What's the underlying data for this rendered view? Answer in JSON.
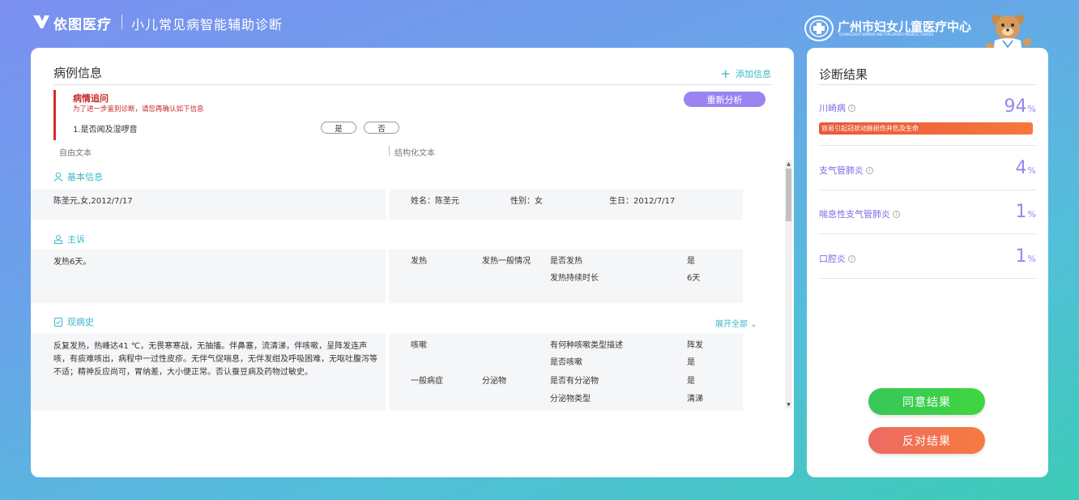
{
  "header": {
    "brand": "依图医疗",
    "app_title": "小儿常见病智能辅助诊断",
    "hospital_name": "广州市妇女儿童医疗中心",
    "hospital_en": "GUANGZHOU WOMEN AND CHILDREN'S MEDICAL CENTER"
  },
  "case": {
    "title": "病例信息",
    "add_info": "添加信息",
    "inquiry": {
      "title": "病情追问",
      "hint": "为了进一步鉴别诊断，请您再确认如下信息",
      "reanalyze": "重新分析",
      "question": "1.是否闻及湿啰音",
      "yes": "是",
      "no": "否"
    },
    "free_text_label": "自由文本",
    "struct_text_label": "结构化文本",
    "basic": {
      "heading": "基本信息",
      "free_text": "陈圣元,女,2012/7/17",
      "name": "姓名：陈圣元",
      "gender": "性别：女",
      "birthday": "生日：2012/7/17"
    },
    "complaint": {
      "heading": "主诉",
      "free_text": "发热6天。",
      "category": "发热",
      "sub_category": "发热一般情况",
      "rows": [
        {
          "label": "是否发热",
          "value": "是"
        },
        {
          "label": "发热持续时长",
          "value": "6天"
        }
      ]
    },
    "history": {
      "heading": "现病史",
      "expand_all": "展开全部",
      "free_text": "反复发热，热峰达41 ℃，无畏寒寒战，无抽搐。伴鼻塞，流清涕，伴咳嗽，呈阵发连声咳，有痰难咳出，病程中一过性皮疹。无伴气促喘息，无伴发绀及呼吸困难，无呕吐腹泻等不适；精神反应尚可，胃纳差，大小便正常。否认蚕豆病及药物过敏史。",
      "cough": {
        "category": "咳嗽",
        "rows": [
          {
            "label": "有何种咳嗽类型描述",
            "value": "阵发"
          },
          {
            "label": "是否咳嗽",
            "value": "是"
          }
        ]
      },
      "general": {
        "category": "一般病症",
        "sub_category": "分泌物",
        "rows": [
          {
            "label": "是否有分泌物",
            "value": "是"
          },
          {
            "label": "分泌物类型",
            "value": "清涕"
          }
        ]
      }
    }
  },
  "diagnosis": {
    "title": "诊断结果",
    "items": [
      {
        "name": "川崎病",
        "pct": "94",
        "unit": "%",
        "warning": "容易引起冠状动脉损伤并危及生命"
      },
      {
        "name": "支气管肺炎",
        "pct": "4",
        "unit": "%"
      },
      {
        "name": "喘息性支气管肺炎",
        "pct": "1",
        "unit": "%"
      },
      {
        "name": "口腔炎",
        "pct": "1",
        "unit": "%"
      }
    ],
    "agree": "同意结果",
    "oppose": "反对结果"
  },
  "colors": {
    "accent_teal": "#3ab7c7",
    "accent_purple": "#9b84f0",
    "warning_red": "#c62828",
    "agree_green": "#3fd63f",
    "oppose_orange": "#f57b40"
  }
}
